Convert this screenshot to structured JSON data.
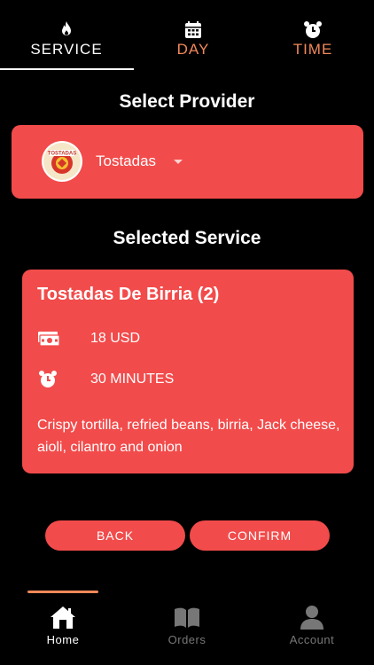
{
  "tabs": [
    {
      "label": "SERVICE",
      "icon": "flame-icon",
      "active": true
    },
    {
      "label": "DAY",
      "icon": "calendar-icon",
      "active": false
    },
    {
      "label": "TIME",
      "icon": "alarm-clock-icon",
      "active": false
    }
  ],
  "provider_section": {
    "title": "Select Provider",
    "provider_name": "Tostadas",
    "logo_text": "TOSTADAS"
  },
  "service_section": {
    "title": "Selected Service",
    "name": "Tostadas De Birria (2)",
    "price": "18 USD",
    "duration": "30 MINUTES",
    "description": "Crispy tortilla, refried beans, birria, Jack cheese, aioli, cilantro and onion"
  },
  "buttons": {
    "back": "BACK",
    "confirm": "CONFIRM"
  },
  "bottom_nav": [
    {
      "label": "Home",
      "icon": "home-icon",
      "active": true
    },
    {
      "label": "Orders",
      "icon": "book-icon",
      "active": false
    },
    {
      "label": "Account",
      "icon": "user-icon",
      "active": false
    }
  ],
  "colors": {
    "accent": "#f24b4b",
    "inactive_tab": "#f2885a",
    "background": "#000000"
  }
}
